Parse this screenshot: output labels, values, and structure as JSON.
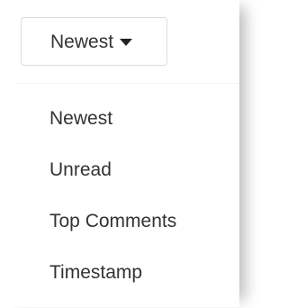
{
  "sort": {
    "selected_label": "Newest",
    "caret_icon": "caret-down-icon",
    "options": [
      {
        "label": "Newest"
      },
      {
        "label": "Unread"
      },
      {
        "label": "Top Comments"
      },
      {
        "label": "Timestamp"
      }
    ]
  }
}
